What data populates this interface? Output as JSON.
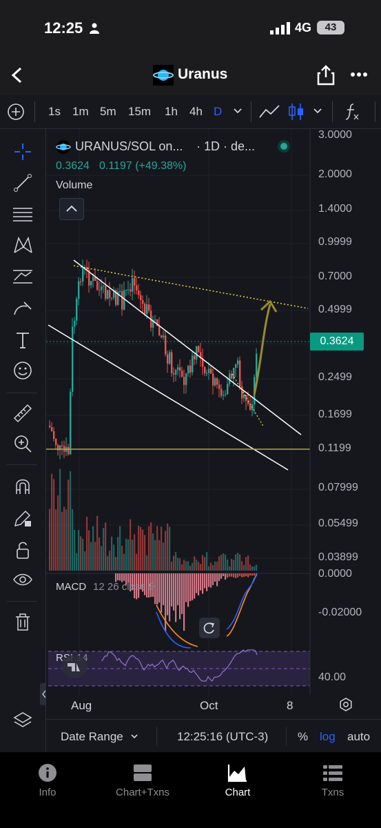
{
  "status": {
    "time": "12:25",
    "network": "4G",
    "battery": "43"
  },
  "header": {
    "title": "Uranus"
  },
  "toolbar": {
    "timeframes": [
      "1s",
      "1m",
      "5m",
      "15m",
      "1h",
      "4h",
      "D"
    ],
    "active": "D"
  },
  "chart": {
    "symbol": "URANUS/SOL on...",
    "interval": "· 1D · de...",
    "last": "0.3624",
    "change": "0.1197 (+49.38%)",
    "volume_label": "Volume",
    "price_ticks": [
      "3.0000",
      "2.0000",
      "1.4000",
      "0.9999",
      "0.7000",
      "0.4999",
      "0.2499",
      "0.1699",
      "0.1199",
      "0.07999",
      "0.05499",
      "0.03899"
    ],
    "price_tag": "0.3624",
    "macd_label": "MACD",
    "macd_params": "12 26 close 9",
    "macd_ticks": [
      "0.0000",
      "-0.02000"
    ],
    "rsi_label": "RSI",
    "rsi_params": "14",
    "rsi_tick": "40.00",
    "x_ticks": [
      "Aug",
      "Oct",
      "8"
    ],
    "colors": {
      "up": "#26a69a",
      "down": "#ef5350",
      "accent": "#2962ff",
      "tag": "#089981",
      "support": "#b7a839"
    }
  },
  "bottombar": {
    "date_range": "Date Range",
    "clock": "12:25:16 (UTC-3)",
    "percent": "%",
    "log": "log",
    "auto": "auto"
  },
  "tabs": [
    {
      "label": "Info",
      "icon": "info-icon"
    },
    {
      "label": "Chart+Txns",
      "icon": "split-icon"
    },
    {
      "label": "Chart",
      "icon": "chart-icon"
    },
    {
      "label": "Txns",
      "icon": "list-icon"
    }
  ]
}
